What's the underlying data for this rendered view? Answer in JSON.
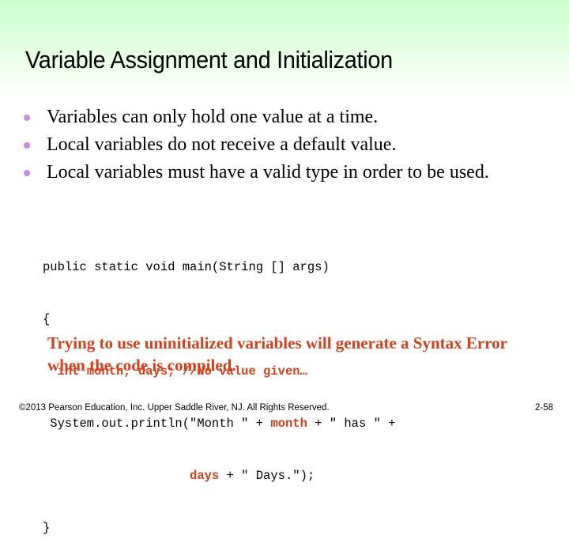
{
  "slide": {
    "title": "Variable Assignment and Initialization",
    "bullets": [
      "Variables can only hold one value at a time.",
      "Local variables do not receive a default value.",
      "Local variables must have a valid type in order to be used."
    ],
    "code": {
      "line1": "public static void main(String [] args)",
      "line2": "{",
      "line3_indent": "  ",
      "line3_hl": "int month, days; //No value given…",
      "line4_a": " System.out.println(\"Month \" + ",
      "line4_hl": "month",
      "line4_b": " + \" has \" +",
      "line5_indent": "                    ",
      "line5_hl": "days",
      "line5_b": " + \" Days.\");",
      "line6": "}"
    },
    "warning": "Trying to use uninitialized variables will generate a Syntax Error when the code is compiled.",
    "footer": {
      "copyright": "©2013 Pearson Education, Inc. Upper Saddle River, NJ. All Rights Reserved.",
      "page_number": "2-58"
    },
    "colors": {
      "header_gradient_top": "#ccffcc",
      "bullet": "#c48fd6",
      "highlight": "#d2401c"
    }
  }
}
